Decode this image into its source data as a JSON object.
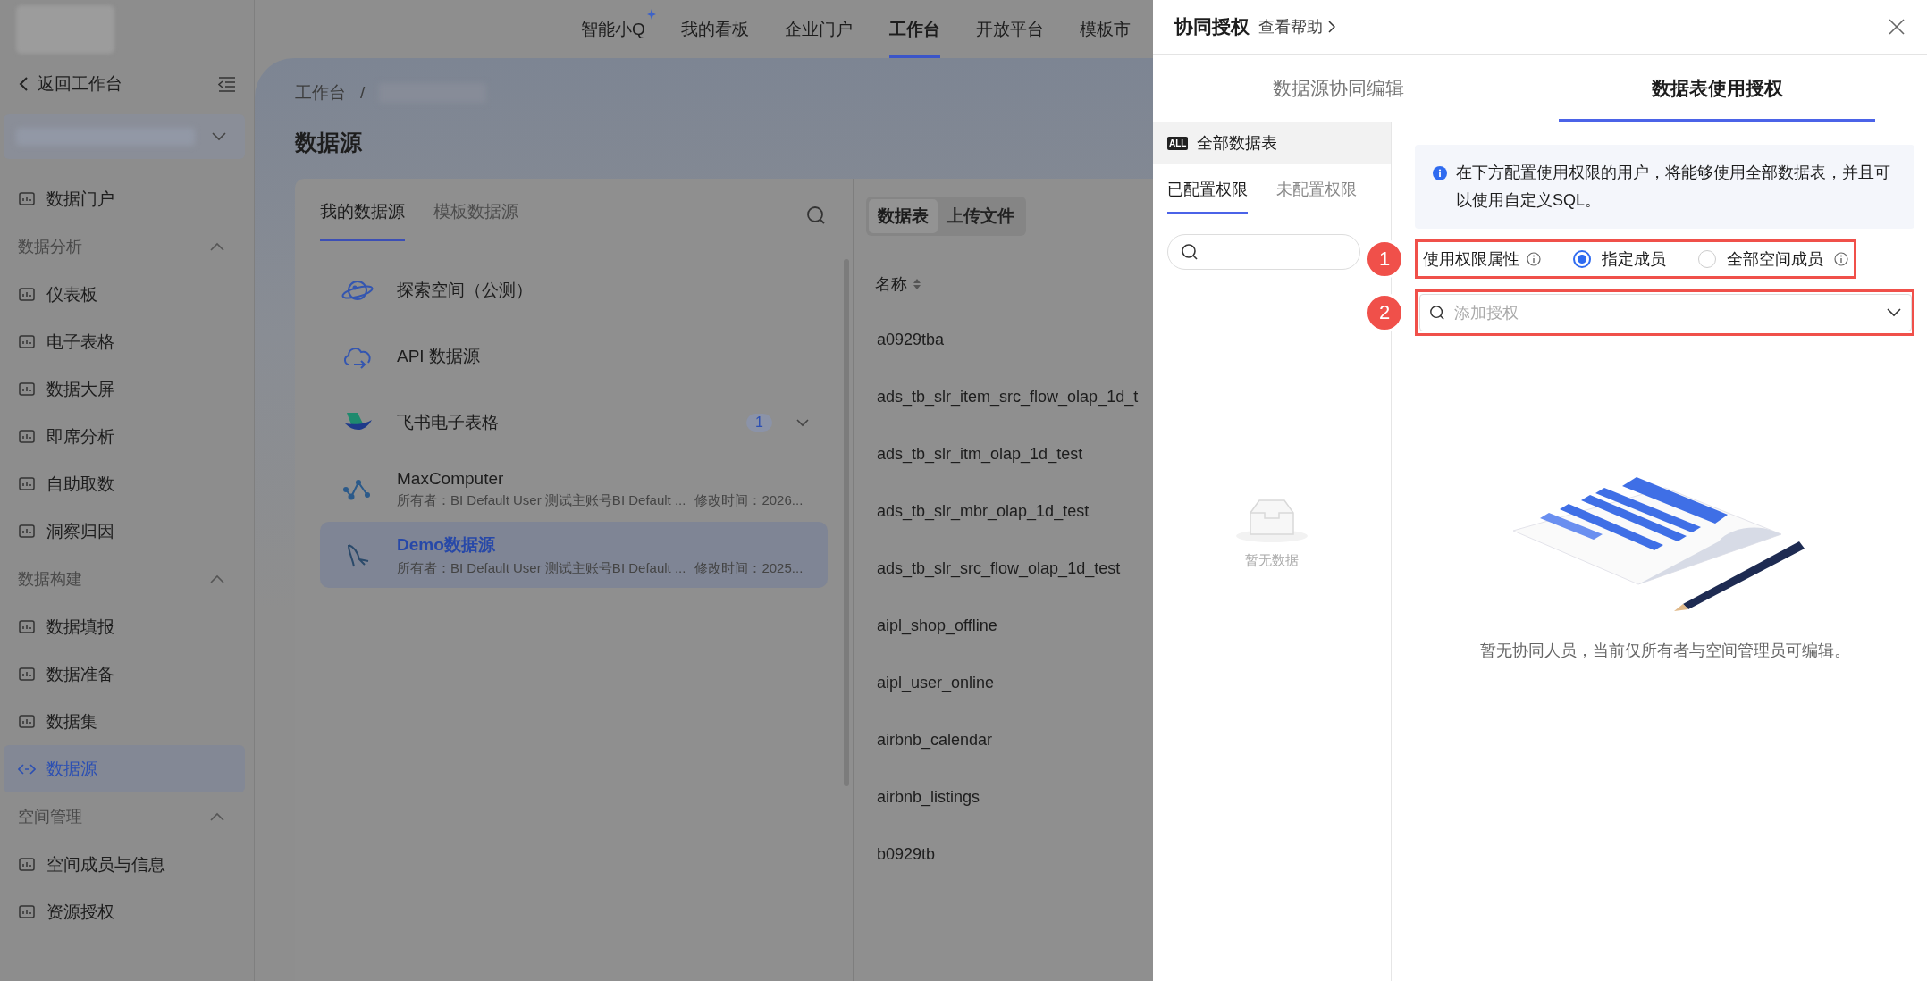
{
  "sidebar": {
    "back_label": "返回工作台",
    "items": [
      {
        "kind": "item",
        "label": "数据门户",
        "selected": false
      },
      {
        "kind": "group",
        "label": "数据分析",
        "expanded": true
      },
      {
        "kind": "item",
        "label": "仪表板",
        "selected": false
      },
      {
        "kind": "item",
        "label": "电子表格",
        "selected": false
      },
      {
        "kind": "item",
        "label": "数据大屏",
        "selected": false
      },
      {
        "kind": "item",
        "label": "即席分析",
        "selected": false
      },
      {
        "kind": "item",
        "label": "自助取数",
        "selected": false
      },
      {
        "kind": "item",
        "label": "洞察归因",
        "selected": false
      },
      {
        "kind": "group",
        "label": "数据构建",
        "expanded": true
      },
      {
        "kind": "item",
        "label": "数据填报",
        "selected": false
      },
      {
        "kind": "item",
        "label": "数据准备",
        "selected": false
      },
      {
        "kind": "item",
        "label": "数据集",
        "selected": false
      },
      {
        "kind": "item",
        "label": "数据源",
        "selected": true
      },
      {
        "kind": "group",
        "label": "空间管理",
        "expanded": true
      },
      {
        "kind": "item",
        "label": "空间成员与信息",
        "selected": false
      },
      {
        "kind": "item",
        "label": "资源授权",
        "selected": false
      }
    ]
  },
  "top_nav": [
    {
      "label": "智能小Q",
      "selected": false,
      "sparkle": true
    },
    {
      "label": "我的看板",
      "selected": false,
      "sparkle": false
    },
    {
      "label": "企业门户",
      "selected": false,
      "sparkle": false
    },
    {
      "label": "工作台",
      "selected": true,
      "sparkle": false
    },
    {
      "label": "开放平台",
      "selected": false,
      "sparkle": false
    },
    {
      "label": "模板市",
      "selected": false,
      "sparkle": false
    }
  ],
  "breadcrumb": {
    "items": [
      "工作台"
    ],
    "separator": "/"
  },
  "page_title": "数据源",
  "source_tabs": [
    {
      "label": "我的数据源",
      "selected": true
    },
    {
      "label": "模板数据源",
      "selected": false
    }
  ],
  "sources": [
    {
      "kind": "planet",
      "name": "探索空间（公测）",
      "selected": false
    },
    {
      "kind": "api",
      "name": "API 数据源",
      "selected": false
    },
    {
      "kind": "feishu",
      "name": "飞书电子表格",
      "badge": "1",
      "selected": false
    },
    {
      "kind": "compute",
      "name": "MaxComputer",
      "owner": "所有者：BI Default User 测试主账号BI Default ...",
      "modified": "修改时间：2026...",
      "selected": false
    },
    {
      "kind": "mysql",
      "name": "Demo数据源",
      "owner": "所有者：BI Default User 测试主账号BI Default ...",
      "modified": "修改时间：2025...",
      "selected": true
    }
  ],
  "table_toggle": [
    {
      "label": "数据表",
      "selected": true
    },
    {
      "label": "上传文件",
      "selected": false
    }
  ],
  "table": {
    "column": "名称",
    "rows": [
      "a0929tba",
      "ads_tb_slr_item_src_flow_olap_1d_t",
      "ads_tb_slr_itm_olap_1d_test",
      "ads_tb_slr_mbr_olap_1d_test",
      "ads_tb_slr_src_flow_olap_1d_test",
      "aipl_shop_offline",
      "aipl_user_online",
      "airbnb_calendar",
      "airbnb_listings",
      "b0929tb"
    ]
  },
  "drawer": {
    "title": "协同授权",
    "help_link": "查看帮助",
    "tabs": [
      {
        "label": "数据源协同编辑",
        "selected": false
      },
      {
        "label": "数据表使用授权",
        "selected": true
      }
    ],
    "all_tables": {
      "badge": "ALL",
      "label": "全部数据表"
    },
    "sub_tabs": [
      {
        "label": "已配置权限",
        "selected": true
      },
      {
        "label": "未配置权限",
        "selected": false
      }
    ],
    "empty_text": "暂无数据",
    "info": "在下方配置使用权限的用户，将能够使用全部数据表，并且可以使用自定义SQL。",
    "markers": [
      "1",
      "2"
    ],
    "permission_label": "使用权限属性",
    "options": [
      {
        "label": "指定成员",
        "selected": true,
        "info": false
      },
      {
        "label": "全部空间成员",
        "selected": false,
        "info": true
      }
    ],
    "add_placeholder": "添加授权",
    "empty_message": "暂无协同人员，当前仅所有者与空间管理员可编辑。"
  }
}
